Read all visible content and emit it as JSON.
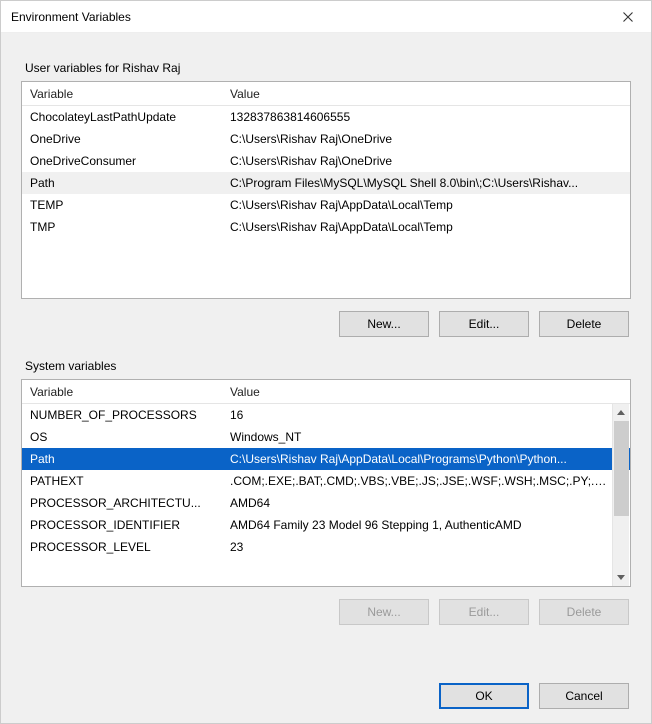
{
  "window": {
    "title": "Environment Variables",
    "close_label": "Close"
  },
  "user_section": {
    "label": "User variables for Rishav Raj",
    "columns": {
      "variable": "Variable",
      "value": "Value"
    },
    "rows": [
      {
        "variable": "ChocolateyLastPathUpdate",
        "value": "132837863814606555"
      },
      {
        "variable": "OneDrive",
        "value": "C:\\Users\\Rishav Raj\\OneDrive"
      },
      {
        "variable": "OneDriveConsumer",
        "value": "C:\\Users\\Rishav Raj\\OneDrive"
      },
      {
        "variable": "Path",
        "value": "C:\\Program Files\\MySQL\\MySQL Shell 8.0\\bin\\;C:\\Users\\Rishav..."
      },
      {
        "variable": "TEMP",
        "value": "C:\\Users\\Rishav Raj\\AppData\\Local\\Temp"
      },
      {
        "variable": "TMP",
        "value": "C:\\Users\\Rishav Raj\\AppData\\Local\\Temp"
      }
    ],
    "selected_index": null,
    "hinted_index": 3,
    "buttons": {
      "new": "New...",
      "edit": "Edit...",
      "delete": "Delete"
    }
  },
  "system_section": {
    "label": "System variables",
    "columns": {
      "variable": "Variable",
      "value": "Value"
    },
    "rows": [
      {
        "variable": "NUMBER_OF_PROCESSORS",
        "value": "16"
      },
      {
        "variable": "OS",
        "value": "Windows_NT"
      },
      {
        "variable": "Path",
        "value": "C:\\Users\\Rishav Raj\\AppData\\Local\\Programs\\Python\\Python..."
      },
      {
        "variable": "PATHEXT",
        "value": ".COM;.EXE;.BAT;.CMD;.VBS;.VBE;.JS;.JSE;.WSF;.WSH;.MSC;.PY;.PYW"
      },
      {
        "variable": "PROCESSOR_ARCHITECTU...",
        "value": "AMD64"
      },
      {
        "variable": "PROCESSOR_IDENTIFIER",
        "value": "AMD64 Family 23 Model 96 Stepping 1, AuthenticAMD"
      },
      {
        "variable": "PROCESSOR_LEVEL",
        "value": "23"
      }
    ],
    "selected_index": 2,
    "buttons": {
      "new": "New...",
      "edit": "Edit...",
      "delete": "Delete"
    },
    "buttons_disabled": true
  },
  "footer": {
    "ok": "OK",
    "cancel": "Cancel"
  }
}
